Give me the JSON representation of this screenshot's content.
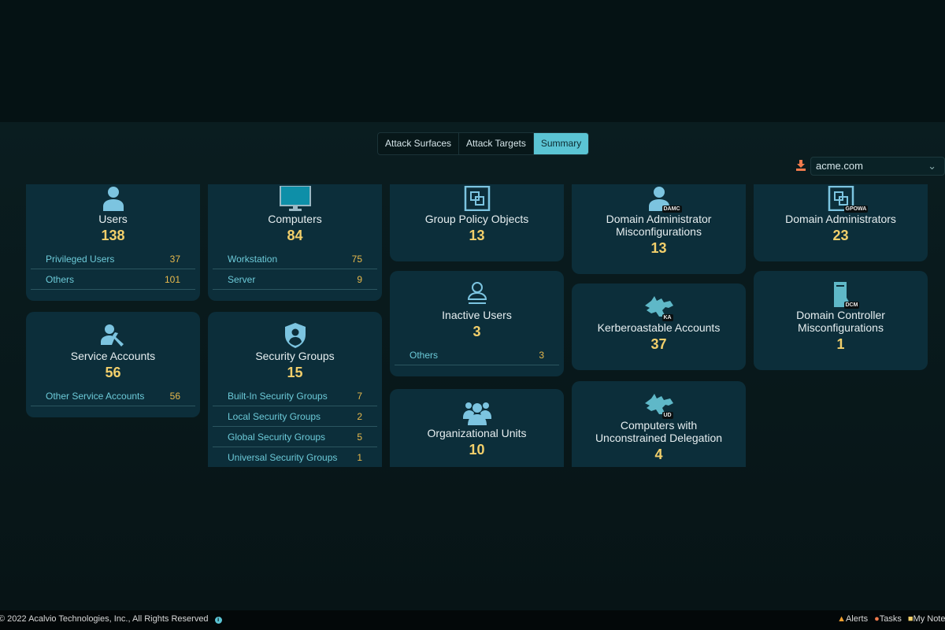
{
  "tabs": [
    {
      "label": "Attack Surfaces",
      "active": false
    },
    {
      "label": "Attack Targets",
      "active": false
    },
    {
      "label": "Summary",
      "active": true
    }
  ],
  "domain_select": {
    "value": "acme.com",
    "download_icon": "download-icon",
    "chevron_icon": "chevron-down-icon"
  },
  "colors": {
    "accent": "#5bc4d4",
    "card": "#0c2e3a",
    "number": "#f2cf6b",
    "row_label": "#6ccad8",
    "row_value": "#e8b94c"
  },
  "cards": [
    {
      "id": "users",
      "col": 0,
      "pos": 0,
      "icon": "user",
      "title": "Users",
      "count": "138",
      "rows": [
        {
          "label": "Privileged Users",
          "value": "37"
        },
        {
          "label": "Others",
          "value": "101"
        }
      ]
    },
    {
      "id": "service-accounts",
      "col": 0,
      "pos": 1,
      "icon": "user-wrench",
      "title": "Service Accounts",
      "count": "56",
      "rows": [
        {
          "label": "Other Service Accounts",
          "value": "56"
        }
      ]
    },
    {
      "id": "computers",
      "col": 1,
      "pos": 0,
      "icon": "monitor",
      "title": "Computers",
      "count": "84",
      "rows": [
        {
          "label": "Workstation",
          "value": "75"
        },
        {
          "label": "Server",
          "value": "9"
        }
      ]
    },
    {
      "id": "security-groups",
      "col": 1,
      "pos": 1,
      "icon": "shield-user",
      "title": "Security Groups",
      "count": "15",
      "rows": [
        {
          "label": "Built-In Security Groups",
          "value": "7"
        },
        {
          "label": "Local Security Groups",
          "value": "2"
        },
        {
          "label": "Global Security Groups",
          "value": "5"
        },
        {
          "label": "Universal Security Groups",
          "value": "1"
        }
      ]
    },
    {
      "id": "group-policy-objects",
      "col": 2,
      "pos": 0,
      "icon": "gpo",
      "title": "Group Policy Objects",
      "count": "13",
      "rows": []
    },
    {
      "id": "inactive-users",
      "col": 2,
      "pos": 1,
      "icon": "user-inactive",
      "title": "Inactive Users",
      "count": "3",
      "rows": [
        {
          "label": "Others",
          "value": "3"
        }
      ]
    },
    {
      "id": "organizational-units",
      "col": 2,
      "pos": 2,
      "icon": "users-group",
      "title": "Organizational Units",
      "count": "10",
      "rows": []
    },
    {
      "id": "domain-admin-misconfigurations",
      "col": 3,
      "pos": 0,
      "icon": "user",
      "badge": "DAMC",
      "title": "Domain Administrator Misconfigurations",
      "count": "13",
      "rows": []
    },
    {
      "id": "kerberoastable-accounts",
      "col": 3,
      "pos": 1,
      "icon": "cerberus",
      "badge": "KA",
      "title": "Kerberoastable Accounts",
      "count": "37",
      "rows": []
    },
    {
      "id": "unconstrained-delegation",
      "col": 3,
      "pos": 2,
      "icon": "cerberus",
      "badge": "UD",
      "title": "Computers with Unconstrained Delegation",
      "count": "4",
      "rows": []
    },
    {
      "id": "domain-administrators",
      "col": 4,
      "pos": 0,
      "icon": "gpo",
      "badge": "GPOWA",
      "title": "Domain Administrators",
      "count": "23",
      "rows": []
    },
    {
      "id": "domain-controller-misconfigurations",
      "col": 4,
      "pos": 1,
      "icon": "server",
      "badge": "DCM",
      "title": "Domain Controller Misconfigurations",
      "count": "1",
      "rows": []
    }
  ],
  "footer": {
    "copyright": "© 2022 Acalvio Technologies, Inc., All Rights Reserved",
    "alerts": "Alerts",
    "tasks": "Tasks",
    "notes": "My Notes"
  }
}
